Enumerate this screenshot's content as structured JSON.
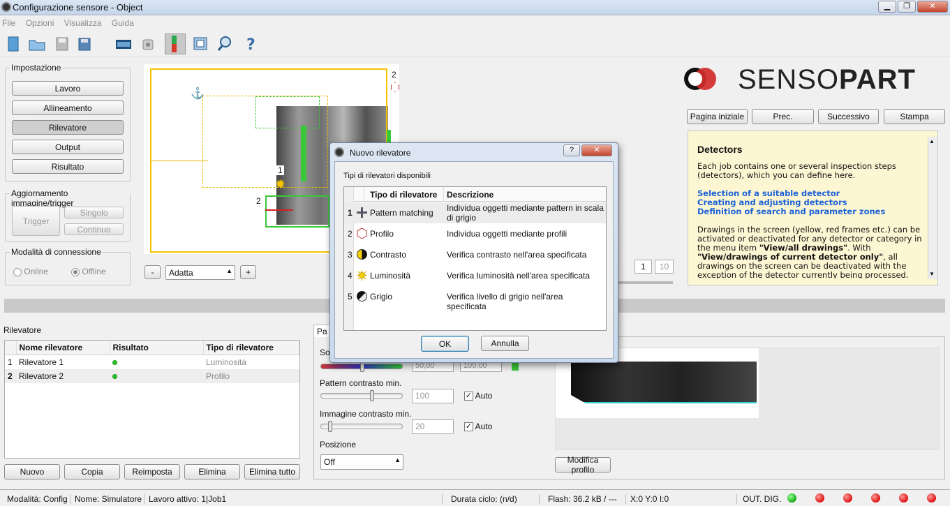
{
  "window": {
    "title": "Configurazione sensore - Object",
    "min": "▁",
    "max": "❐",
    "close": "✕"
  },
  "menu": [
    "File",
    "Opzioni",
    "Visualizza",
    "Guida"
  ],
  "setup": {
    "title": "Impostazione",
    "buttons": [
      "Lavoro",
      "Allineamento",
      "Rilevatore",
      "Output",
      "Risultato"
    ],
    "selected": "Rilevatore"
  },
  "trigger": {
    "title": "Aggiornamento immagine/trigger",
    "trigger": "Trigger",
    "single": "Singolo",
    "continuous": "Continuo"
  },
  "connection": {
    "title": "Modalità di connessione",
    "online": "Online",
    "offline": "Offline",
    "selected": "Offline"
  },
  "image": {
    "label_1": "1",
    "label_2": "2",
    "label_2b": "2"
  },
  "zoom": {
    "minus": "-",
    "value": "Adatta",
    "plus": "+"
  },
  "nav_page": {
    "current": "1",
    "total": "10"
  },
  "brand": {
    "name_light": "SENSO",
    "name_bold": "PART"
  },
  "help_nav": {
    "home": "Pagina iniziale",
    "prev": "Prec.",
    "next": "Successivo",
    "print": "Stampa"
  },
  "help": {
    "title": "Detectors",
    "intro": "Each job contains one or several inspection steps (detectors), which you can define here.",
    "links": [
      "Selection of a suitable detector",
      "Creating and adjusting detectors",
      "Definition of search and parameter zones"
    ],
    "p2_a": "Drawings in the screen (yellow, red frames etc.) can be activated or deactivated for any detector or category in the menu item ",
    "p2_b": "\"View/all drawings\"",
    "p2_c": ". With ",
    "p2_d": "\"View/drawings of current detector only\"",
    "p2_e": ", all drawings on the screen can be deactivated with the exception of the detector currently being processed."
  },
  "detectors": {
    "section": "Rilevatore",
    "columns": [
      "Nome rilevatore",
      "Risultato",
      "Tipo di rilevatore"
    ],
    "rows": [
      {
        "n": "1",
        "name": "Rilevatore 1",
        "type": "Luminosità"
      },
      {
        "n": "2",
        "name": "Rilevatore 2",
        "type": "Profilo"
      }
    ],
    "buttons": [
      "Nuovo",
      "Copia",
      "Reimposta",
      "Elimina",
      "Elimina tutto"
    ]
  },
  "params": {
    "tab": "Pa",
    "so": "So",
    "val_a": "50,00",
    "val_b": "100,00",
    "pattern_label": "Pattern contrasto min.",
    "pattern_value": "100",
    "image_label": "Immagine contrasto min.",
    "image_value": "20",
    "auto": "Auto",
    "pos_label": "Posizione",
    "pos_value": "Off",
    "modify": "Modifica profilo"
  },
  "dialog": {
    "title": "Nuovo rilevatore",
    "help": "?",
    "close": "✕",
    "subtitle": "Tipi di rilevatori disponibili",
    "columns": [
      "Tipo di rilevatore",
      "Descrizione"
    ],
    "rows": [
      {
        "n": "1",
        "type": "Pattern matching",
        "desc": "Individua oggetti mediante pattern in scala di grigio"
      },
      {
        "n": "2",
        "type": "Profilo",
        "desc": "Individua oggetti mediante profili"
      },
      {
        "n": "3",
        "type": "Contrasto",
        "desc": "Verifica contrasto nell'area specificata"
      },
      {
        "n": "4",
        "type": "Luminosità",
        "desc": "Verifica luminosità nell'area specificata"
      },
      {
        "n": "5",
        "type": "Grigio",
        "desc": "Verifica livello di grigio nell'area specificata"
      }
    ],
    "ok": "OK",
    "cancel": "Annulla"
  },
  "status": {
    "mode": "Modalità:   Config",
    "name": "Nome:   Simulatore",
    "job": "Lavoro attivo:   1|Job1",
    "cycle": "Durata ciclo:   (n/d)",
    "flash": "Flash:   36.2 kB / ---",
    "xy": "X:0 Y:0 I:0",
    "out": "OUT. DIG.",
    "leds": [
      "green",
      "red",
      "red",
      "red",
      "red",
      "red"
    ]
  }
}
